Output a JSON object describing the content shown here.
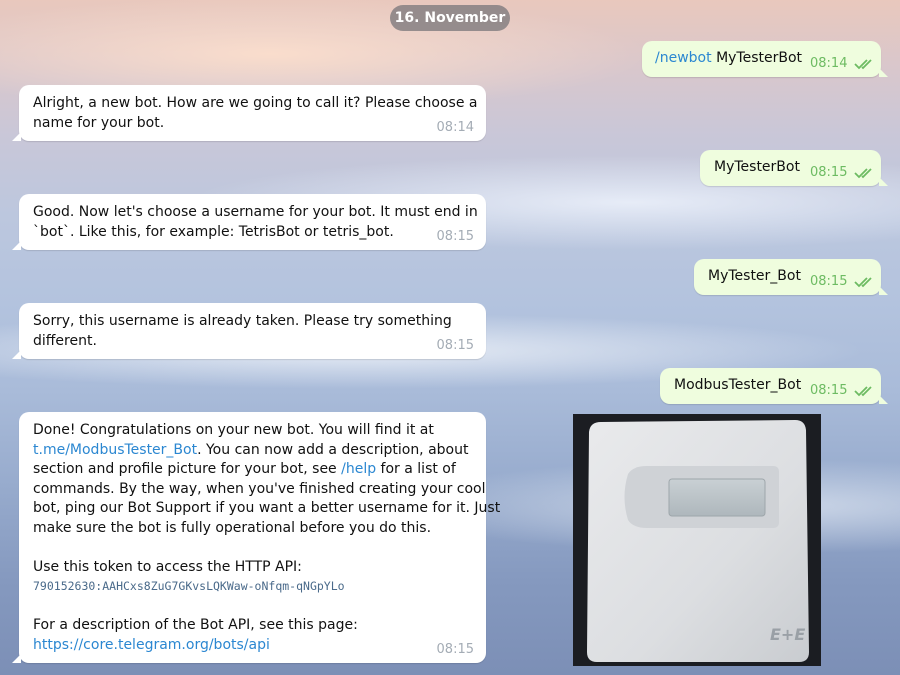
{
  "date_divider": "16. November",
  "messages": {
    "m1": {
      "cmd": "/newbot",
      "text": "MyTesterBot",
      "time": "08:14"
    },
    "m2": {
      "line1": "Alright, a new bot. How are we going to call it? Please choose a",
      "line2": "name for your bot.",
      "time": "08:14"
    },
    "m3": {
      "text": "MyTesterBot",
      "time": "08:15"
    },
    "m4": {
      "line1": "Good. Now let's choose a username for your bot. It must end in",
      "line2": "`bot`. Like this, for example: TetrisBot or tetris_bot.",
      "time": "08:15"
    },
    "m5": {
      "text": "MyTester_Bot",
      "time": "08:15"
    },
    "m6": {
      "line1": "Sorry, this username is already taken. Please try something",
      "line2": "different.",
      "time": "08:15"
    },
    "m7": {
      "text": "ModbusTester_Bot",
      "time": "08:15"
    },
    "m8": {
      "line1": "Done! Congratulations on your new bot. You will find it at",
      "line2_link": "t.me/ModbusTester_Bot",
      "line2_rest": ". You can now add a description, about",
      "line3": "section and profile picture for your bot, see ",
      "line3_link": "/help",
      "line3_rest": " for a list of",
      "line4": "commands. By the way, when you've finished creating your cool",
      "line5": "bot, ping our Bot Support if you want a better username for it. Just",
      "line6": "make sure the bot is fully operational before you do this.",
      "line7": "Use this token to access the HTTP API:",
      "token": "790152630:AAHCxs8ZuG7GKvsLQKWaw-oNfqm-qNGpYLo",
      "line8": "For a description of the Bot API, see this page:",
      "api_link": "https://core.telegram.org/bots/api",
      "time": "08:15"
    }
  },
  "photo": {
    "brand_mark": "E+E"
  },
  "colors": {
    "outgoing_bubble": "#effdde",
    "incoming_bubble": "#ffffff",
    "link": "#2b87d1",
    "read_checks": "#6dbb62"
  }
}
